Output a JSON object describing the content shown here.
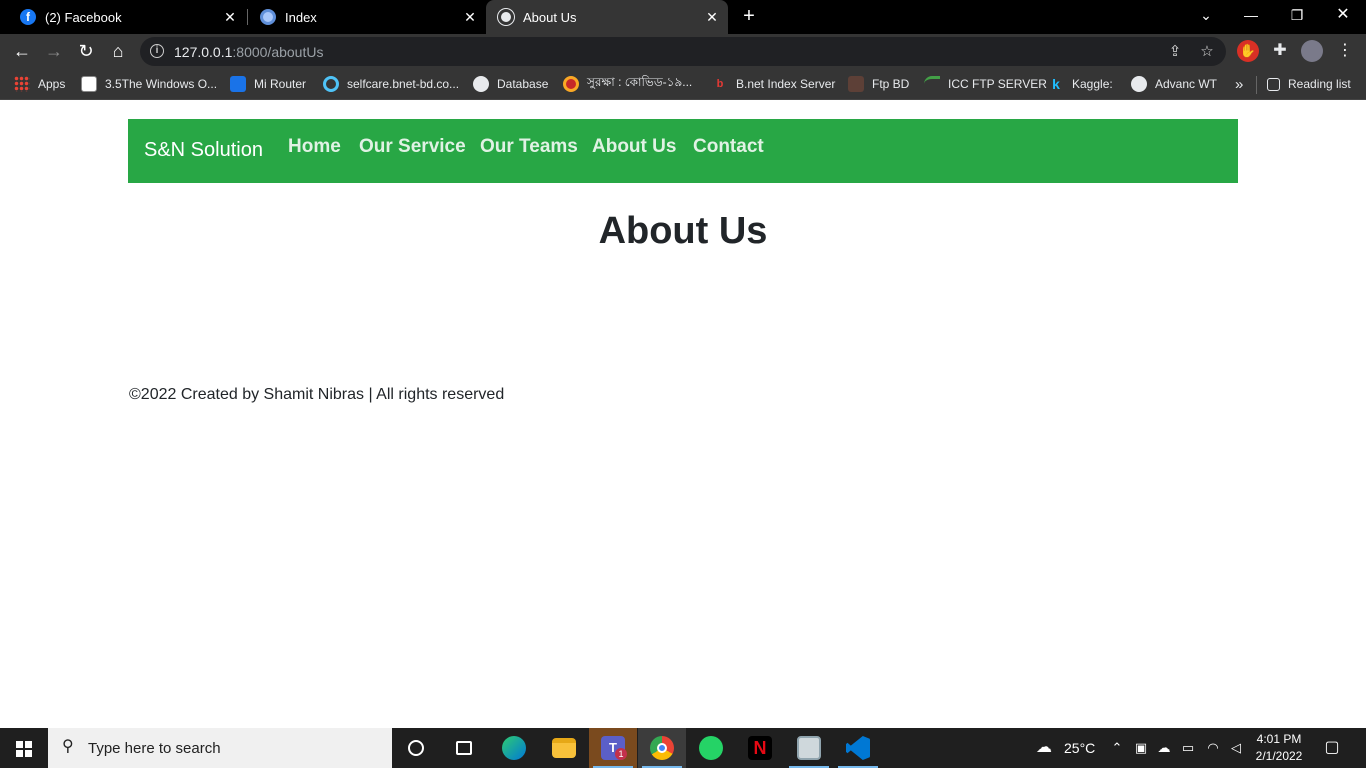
{
  "browser": {
    "tabs": [
      {
        "title": "(2) Facebook",
        "icon": "facebook-icon",
        "color": "#1877f2",
        "active": false
      },
      {
        "title": "Index",
        "icon": "globe-icon",
        "color": "#a8c7fa",
        "active": false
      },
      {
        "title": "About Us",
        "icon": "globe-icon",
        "color": "#e8eaed",
        "active": true
      }
    ],
    "new_tab_label": "+",
    "url_host": "127.0.0.1",
    "url_path": ":8000/aboutUs",
    "bookmarks": [
      {
        "label": "Apps",
        "icon": "apps-grid-icon"
      },
      {
        "label": "3.5The Windows O...",
        "icon": "cisco-icon"
      },
      {
        "label": "Mi Router",
        "icon": "wifi-icon"
      },
      {
        "label": "selfcare.bnet-bd.co...",
        "icon": "circle-icon"
      },
      {
        "label": "Database",
        "icon": "globe-icon"
      },
      {
        "label": "সুরক্ষা : কোভিড-১৯...",
        "icon": "seal-icon"
      },
      {
        "label": "B.net Index Server",
        "icon": "bnet-icon"
      },
      {
        "label": "Ftp BD",
        "icon": "ftp-icon"
      },
      {
        "label": "ICC FTP SERVER",
        "icon": "icc-icon"
      },
      {
        "label": "Kaggle:",
        "icon": "kaggle-icon"
      },
      {
        "label": "Advanc WT",
        "icon": "globe-icon"
      }
    ],
    "more_bookmarks": "»",
    "reading_list": "Reading list"
  },
  "site": {
    "brand": "S&N Solution",
    "nav": [
      "Home",
      "Our Service",
      "Our Teams",
      "About Us",
      "Contact"
    ],
    "heading": "About Us",
    "footer": "©2022 Created by Shamit Nibras | All rights reserved",
    "accent_color": "#28a745"
  },
  "taskbar": {
    "search_placeholder": "Type here to search",
    "weather": "25°C",
    "time": "4:01 PM",
    "date": "2/1/2022",
    "teams_badge": "1"
  }
}
